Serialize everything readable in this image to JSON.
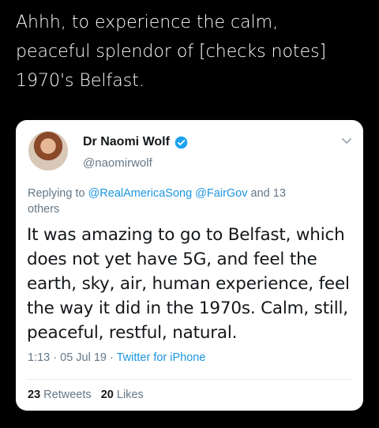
{
  "caption": {
    "lines": [
      "Ahhh, to experience the calm,",
      "peaceful splendor of [checks notes]",
      "1970's Belfast."
    ]
  },
  "tweet": {
    "author_name": "Dr Naomi Wolf",
    "handle": "@naomirwolf",
    "reply_prefix": "Replying to ",
    "reply_user1": "@RealAmericaSong",
    "reply_user2": "@FairGov",
    "reply_suffix": " and 13",
    "reply_line2": "others",
    "body_lines": [
      "It was amazing to go to Belfast, which",
      "does not yet have 5G, and feel the",
      "earth, sky, air, human experience, feel",
      "the way it did in the 1970s. Calm, still,",
      "peaceful, restful, natural."
    ],
    "time": "1:13",
    "date": "05 Jul 19",
    "source": "Twitter for iPhone",
    "retweets_count": "23",
    "retweets_label": "Retweets",
    "likes_count": "20",
    "likes_label": "Likes"
  },
  "icons": {
    "verified": "verified-badge-icon",
    "chevron": "chevron-down-icon",
    "accent": "#1da1f2"
  }
}
